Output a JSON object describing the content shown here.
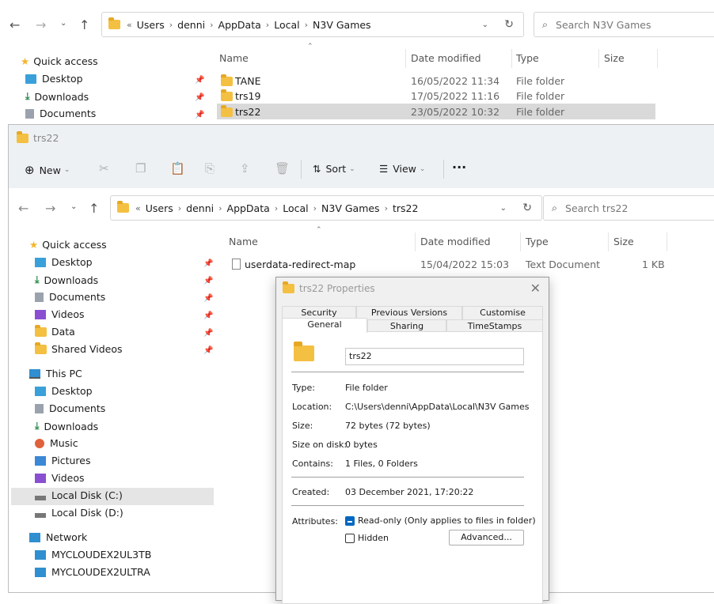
{
  "back": {
    "address": [
      "Users",
      "denni",
      "AppData",
      "Local",
      "N3V Games"
    ],
    "search_placeholder": "Search N3V Games",
    "columns": [
      "Name",
      "Date modified",
      "Type",
      "Size"
    ],
    "nav": [
      {
        "label": "Quick access",
        "icon": "star-icon"
      },
      {
        "label": "Desktop",
        "icon": "desktop-icon"
      },
      {
        "label": "Downloads",
        "icon": "download-icon"
      },
      {
        "label": "Documents",
        "icon": "documents-icon"
      }
    ],
    "files": [
      {
        "name": "TANE",
        "date": "16/05/2022 11:34",
        "type": "File folder"
      },
      {
        "name": "trs19",
        "date": "17/05/2022 11:16",
        "type": "File folder"
      },
      {
        "name": "trs22",
        "date": "23/05/2022 10:32",
        "type": "File folder"
      }
    ]
  },
  "front": {
    "title": "trs22",
    "toolbar": {
      "new": "New",
      "sort": "Sort",
      "view": "View",
      "more": "···"
    },
    "address": [
      "Users",
      "denni",
      "AppData",
      "Local",
      "N3V Games",
      "trs22"
    ],
    "search_placeholder": "Search trs22",
    "columns": [
      "Name",
      "Date modified",
      "Type",
      "Size"
    ],
    "nav": [
      {
        "label": "Quick access",
        "icon": "star-icon"
      },
      {
        "label": "Desktop",
        "icon": "desktop-icon"
      },
      {
        "label": "Downloads",
        "icon": "download-icon"
      },
      {
        "label": "Documents",
        "icon": "documents-icon"
      },
      {
        "label": "Videos",
        "icon": "videos-icon"
      },
      {
        "label": "Data",
        "icon": "folder-icon"
      },
      {
        "label": "Shared Videos",
        "icon": "folder-icon"
      },
      {
        "label": "This PC",
        "icon": "monitor-icon"
      },
      {
        "label": "Desktop",
        "icon": "desktop-icon"
      },
      {
        "label": "Documents",
        "icon": "documents-icon"
      },
      {
        "label": "Downloads",
        "icon": "download-icon"
      },
      {
        "label": "Music",
        "icon": "music-icon"
      },
      {
        "label": "Pictures",
        "icon": "pictures-icon"
      },
      {
        "label": "Videos",
        "icon": "videos-icon"
      },
      {
        "label": "Local Disk (C:)",
        "icon": "drive-icon"
      },
      {
        "label": "Local Disk (D:)",
        "icon": "drive-icon"
      },
      {
        "label": "Network",
        "icon": "network-icon"
      },
      {
        "label": "MYCLOUDEX2UL3TB",
        "icon": "network-drive-icon"
      },
      {
        "label": "MYCLOUDEX2ULTRA",
        "icon": "network-drive-icon"
      }
    ],
    "file": {
      "name": "userdata-redirect-map",
      "date": "15/04/2022 15:03",
      "type": "Text Document",
      "size": "1 KB"
    }
  },
  "dialog": {
    "title": "trs22 Properties",
    "tabs_top": [
      "Security",
      "Previous Versions",
      "Customise"
    ],
    "tabs_bottom": [
      "General",
      "Sharing",
      "TimeStamps"
    ],
    "name_value": "trs22",
    "props": [
      {
        "label": "Type:",
        "value": "File folder"
      },
      {
        "label": "Location:",
        "value": "C:\\Users\\denni\\AppData\\Local\\N3V Games"
      },
      {
        "label": "Size:",
        "value": "72 bytes (72 bytes)"
      },
      {
        "label": "Size on disk:",
        "value": "0 bytes"
      },
      {
        "label": "Contains:",
        "value": "1 Files, 0 Folders"
      }
    ],
    "created_label": "Created:",
    "created_value": "03 December 2021, 17:20:22",
    "attributes_label": "Attributes:",
    "readonly_label": "Read-only (Only applies to files in folder)",
    "hidden_label": "Hidden",
    "advanced_label": "Advanced..."
  }
}
